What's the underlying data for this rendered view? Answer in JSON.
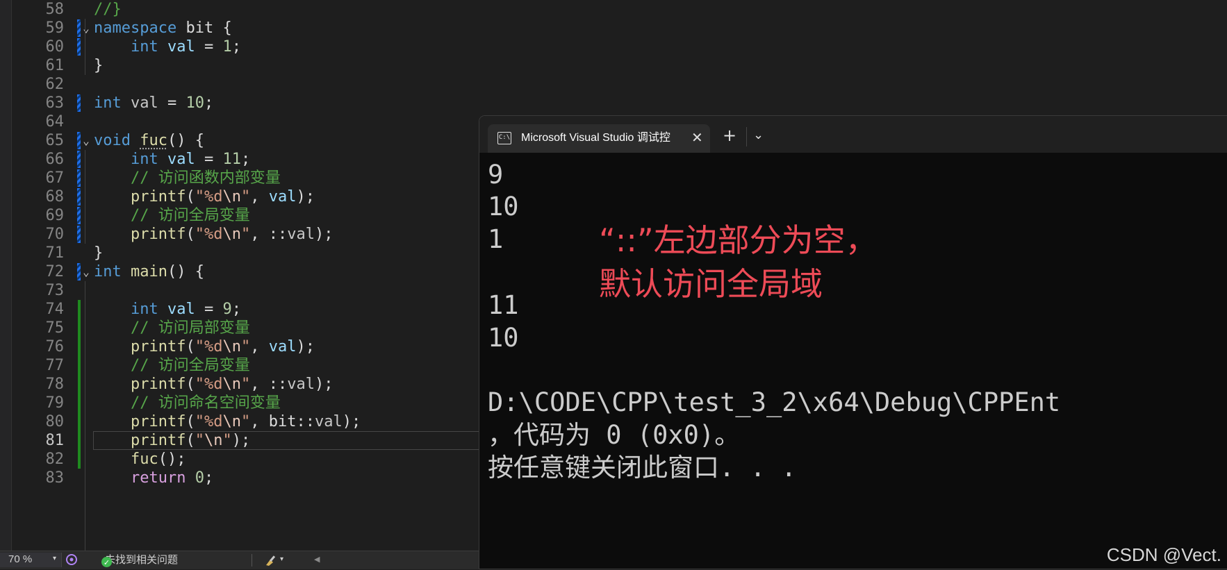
{
  "editor": {
    "lines": [
      {
        "n": "58",
        "tokens": [
          [
            "cm",
            "//}"
          ]
        ]
      },
      {
        "n": "59",
        "tokens": [
          [
            "kw",
            "namespace"
          ],
          [
            "pl",
            " bit {"
          ]
        ]
      },
      {
        "n": "60",
        "tokens": [
          [
            "pl",
            "    "
          ],
          [
            "kw",
            "int"
          ],
          [
            "var",
            " val"
          ],
          [
            "pl",
            " = "
          ],
          [
            "num",
            "1"
          ],
          [
            "pl",
            ";"
          ]
        ]
      },
      {
        "n": "61",
        "tokens": [
          [
            "pl",
            "}"
          ]
        ]
      },
      {
        "n": "62",
        "tokens": []
      },
      {
        "n": "63",
        "tokens": [
          [
            "kw",
            "int"
          ],
          [
            "gvar",
            " val"
          ],
          [
            "pl",
            " = "
          ],
          [
            "num",
            "10"
          ],
          [
            "pl",
            ";"
          ]
        ]
      },
      {
        "n": "64",
        "tokens": []
      },
      {
        "n": "65",
        "tokens": [
          [
            "kw",
            "void"
          ],
          [
            "pl",
            " "
          ],
          [
            "fn squig",
            "fuc"
          ],
          [
            "pl",
            "() {"
          ]
        ]
      },
      {
        "n": "66",
        "tokens": [
          [
            "pl",
            "    "
          ],
          [
            "kw",
            "int"
          ],
          [
            "var",
            " val"
          ],
          [
            "pl",
            " = "
          ],
          [
            "num",
            "11"
          ],
          [
            "pl",
            ";"
          ]
        ]
      },
      {
        "n": "67",
        "tokens": [
          [
            "pl",
            "    "
          ],
          [
            "cm",
            "// 访问函数内部变量"
          ]
        ]
      },
      {
        "n": "68",
        "tokens": [
          [
            "pl",
            "    "
          ],
          [
            "fn",
            "printf"
          ],
          [
            "pl",
            "("
          ],
          [
            "str",
            "\"%d"
          ],
          [
            "esc",
            "\\n"
          ],
          [
            "str",
            "\""
          ],
          [
            "pl",
            ", "
          ],
          [
            "var",
            "val"
          ],
          [
            "pl",
            ");"
          ]
        ]
      },
      {
        "n": "69",
        "tokens": [
          [
            "pl",
            "    "
          ],
          [
            "cm",
            "// 访问全局变量"
          ]
        ]
      },
      {
        "n": "70",
        "tokens": [
          [
            "pl",
            "    "
          ],
          [
            "fn",
            "printf"
          ],
          [
            "pl",
            "("
          ],
          [
            "str",
            "\"%d"
          ],
          [
            "esc",
            "\\n"
          ],
          [
            "str",
            "\""
          ],
          [
            "pl",
            ", ::"
          ],
          [
            "gvar",
            "val"
          ],
          [
            "pl",
            ");"
          ]
        ]
      },
      {
        "n": "71",
        "tokens": [
          [
            "pl",
            "}"
          ]
        ]
      },
      {
        "n": "72",
        "tokens": [
          [
            "kw",
            "int"
          ],
          [
            "pl",
            " "
          ],
          [
            "fn",
            "main"
          ],
          [
            "pl",
            "() {"
          ]
        ]
      },
      {
        "n": "73",
        "tokens": []
      },
      {
        "n": "74",
        "tokens": [
          [
            "pl",
            "    "
          ],
          [
            "kw",
            "int"
          ],
          [
            "var",
            " val"
          ],
          [
            "pl",
            " = "
          ],
          [
            "num",
            "9"
          ],
          [
            "pl",
            ";"
          ]
        ]
      },
      {
        "n": "75",
        "tokens": [
          [
            "pl",
            "    "
          ],
          [
            "cm",
            "// 访问局部变量"
          ]
        ]
      },
      {
        "n": "76",
        "tokens": [
          [
            "pl",
            "    "
          ],
          [
            "fn",
            "printf"
          ],
          [
            "pl",
            "("
          ],
          [
            "str",
            "\"%d"
          ],
          [
            "esc",
            "\\n"
          ],
          [
            "str",
            "\""
          ],
          [
            "pl",
            ", "
          ],
          [
            "var",
            "val"
          ],
          [
            "pl",
            ");"
          ]
        ]
      },
      {
        "n": "77",
        "tokens": [
          [
            "pl",
            "    "
          ],
          [
            "cm",
            "// 访问全局变量"
          ]
        ]
      },
      {
        "n": "78",
        "tokens": [
          [
            "pl",
            "    "
          ],
          [
            "fn",
            "printf"
          ],
          [
            "pl",
            "("
          ],
          [
            "str",
            "\"%d"
          ],
          [
            "esc",
            "\\n"
          ],
          [
            "str",
            "\""
          ],
          [
            "pl",
            ", ::"
          ],
          [
            "gvar",
            "val"
          ],
          [
            "pl",
            ");"
          ]
        ]
      },
      {
        "n": "79",
        "tokens": [
          [
            "pl",
            "    "
          ],
          [
            "cm",
            "// 访问命名空间变量"
          ]
        ]
      },
      {
        "n": "80",
        "tokens": [
          [
            "pl",
            "    "
          ],
          [
            "fn",
            "printf"
          ],
          [
            "pl",
            "("
          ],
          [
            "str",
            "\"%d"
          ],
          [
            "esc",
            "\\n"
          ],
          [
            "str",
            "\""
          ],
          [
            "pl",
            ", "
          ],
          [
            "pl",
            "bit::"
          ],
          [
            "gvar",
            "val"
          ],
          [
            "pl",
            ");"
          ]
        ]
      },
      {
        "n": "81",
        "tokens": [
          [
            "pl",
            "    "
          ],
          [
            "fn",
            "printf"
          ],
          [
            "pl",
            "("
          ],
          [
            "str",
            "\""
          ],
          [
            "esc",
            "\\n"
          ],
          [
            "str",
            "\""
          ],
          [
            "pl",
            ");"
          ]
        ]
      },
      {
        "n": "82",
        "tokens": [
          [
            "pl",
            "    "
          ],
          [
            "fn",
            "fuc"
          ],
          [
            "pl",
            "();"
          ]
        ]
      },
      {
        "n": "83",
        "tokens": [
          [
            "pl",
            "    "
          ],
          [
            "kw2",
            "return"
          ],
          [
            "pl",
            " "
          ],
          [
            "num",
            "0"
          ],
          [
            "pl",
            ";"
          ]
        ]
      }
    ]
  },
  "statusbar": {
    "zoom": "70 %",
    "issues": "未找到相关问题",
    "ok_icon": "check-circle-icon"
  },
  "terminal": {
    "tab_title": "Microsoft Visual Studio 调试控",
    "tab_icon": "console-icon",
    "tab_icon_text": "C:\\",
    "close_glyph": "✕",
    "add_glyph": "+",
    "dropdown_glyph": "⌄",
    "output": [
      "9",
      "10",
      "1",
      "",
      "11",
      "10",
      "",
      "D:\\CODE\\CPP\\test_3_2\\x64\\Debug\\CPPEnt",
      "，代码为 0 (0x0)。",
      "按任意键关闭此窗口. . ."
    ]
  },
  "annotation": {
    "line1": "“::”左边部分为空，",
    "line2": "默认访问全局域",
    "color": "#ee4b57"
  },
  "watermark": "CSDN @Vect."
}
